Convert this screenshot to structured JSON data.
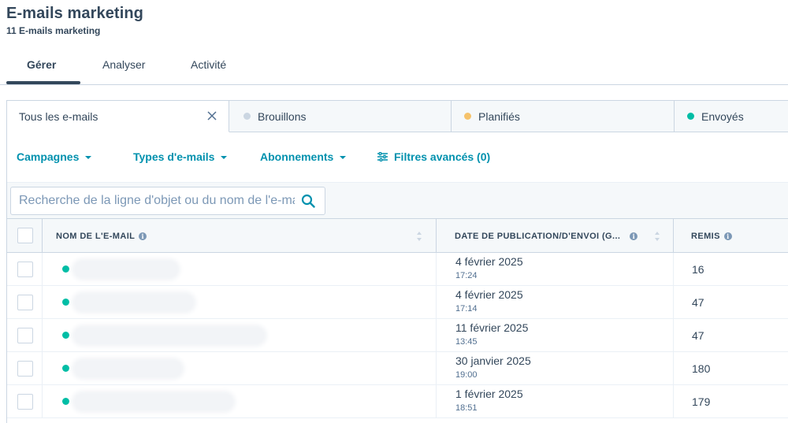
{
  "header": {
    "title": "E-mails marketing",
    "subtitle": "11 E-mails marketing"
  },
  "main_tabs": [
    {
      "label": "Gérer",
      "active": true
    },
    {
      "label": "Analyser",
      "active": false
    },
    {
      "label": "Activité",
      "active": false
    }
  ],
  "view_tabs": [
    {
      "label": "Tous les e-mails",
      "active": true,
      "dot_color": ""
    },
    {
      "label": "Brouillons",
      "active": false,
      "dot_color": "#cbd6e2"
    },
    {
      "label": "Planifiés",
      "active": false,
      "dot_color": "#f5c26b"
    },
    {
      "label": "Envoyés",
      "active": false,
      "dot_color": "#00bda5"
    }
  ],
  "filters": {
    "campaigns": "Campagnes",
    "email_types": "Types d'e-mails",
    "subscriptions": "Abonnements",
    "advanced": "Filtres avancés (0)"
  },
  "search": {
    "placeholder": "Recherche de la ligne d'objet ou du nom de l'e-mail",
    "value": ""
  },
  "table": {
    "columns": {
      "name": "NOM DE L'E-MAIL",
      "date": "DATE DE PUBLICATION/D'ENVOI (G...",
      "delivered": "REMIS"
    },
    "rows": [
      {
        "status_color": "#00bda5",
        "date": "4 février 2025",
        "time": "17:24",
        "delivered": "16"
      },
      {
        "status_color": "#00bda5",
        "date": "4 février 2025",
        "time": "17:14",
        "delivered": "47"
      },
      {
        "status_color": "#00bda5",
        "date": "11 février 2025",
        "time": "13:45",
        "delivered": "47"
      },
      {
        "status_color": "#00bda5",
        "date": "30 janvier 2025",
        "time": "19:00",
        "delivered": "180"
      },
      {
        "status_color": "#00bda5",
        "date": "1 février 2025",
        "time": "18:51",
        "delivered": "179"
      }
    ]
  },
  "colors": {
    "accent": "#0091ae",
    "text": "#33475b",
    "sent": "#00bda5",
    "scheduled": "#f5c26b",
    "draft": "#cbd6e2"
  }
}
